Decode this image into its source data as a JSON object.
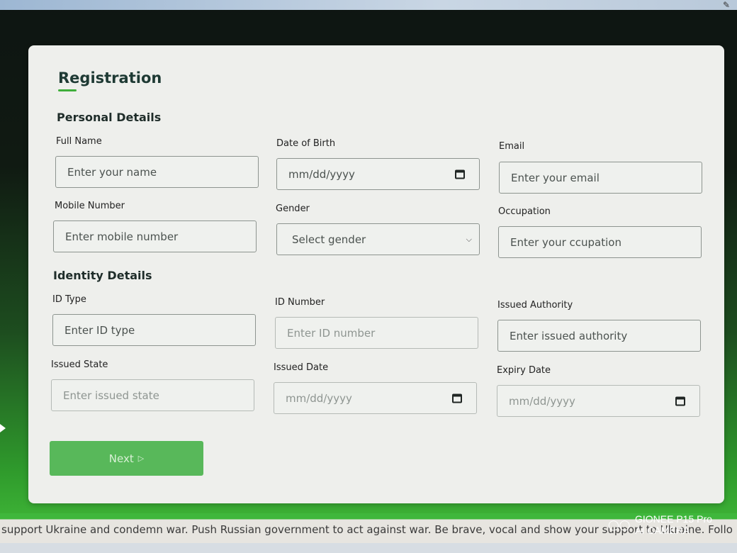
{
  "form": {
    "title": "Registration",
    "personal_section": "Personal Details",
    "identity_section": "Identity Details",
    "next_label": "Next",
    "next_icon": "play-arrow-icon"
  },
  "personal": {
    "full_name": {
      "label": "Full Name",
      "placeholder": "Enter your name"
    },
    "dob": {
      "label": "Date of Birth",
      "placeholder": "mm/dd/yyyy"
    },
    "email": {
      "label": "Email",
      "placeholder": "Enter your email"
    },
    "mobile": {
      "label": "Mobile Number",
      "placeholder": "Enter mobile number"
    },
    "gender": {
      "label": "Gender",
      "selected": "Select gender"
    },
    "occupation": {
      "label": "Occupation",
      "placeholder": "Enter your ccupation"
    }
  },
  "identity": {
    "id_type": {
      "label": "ID Type",
      "placeholder": "Enter ID type"
    },
    "id_number": {
      "label": "ID Number",
      "placeholder": "Enter ID number"
    },
    "issued_authority": {
      "label": "Issued Authority",
      "placeholder": "Enter issued authority"
    },
    "issued_state": {
      "label": "Issued State",
      "placeholder": "Enter issued state"
    },
    "issued_date": {
      "label": "Issued Date",
      "placeholder": "mm/dd/yyyy"
    },
    "expiry_date": {
      "label": "Expiry Date",
      "placeholder": "mm/dd/yyyy"
    }
  },
  "ticker": "support Ukraine and condemn war. Push Russian government to act against war. Be brave, vocal and show your support to Ukraine. Follo",
  "watermark": {
    "line1": "GIONEE P15 Pro",
    "line2": "AI CAMERA"
  },
  "colors": {
    "accent": "#3fae3b",
    "button": "#58b85a",
    "card": "#eeefec"
  }
}
